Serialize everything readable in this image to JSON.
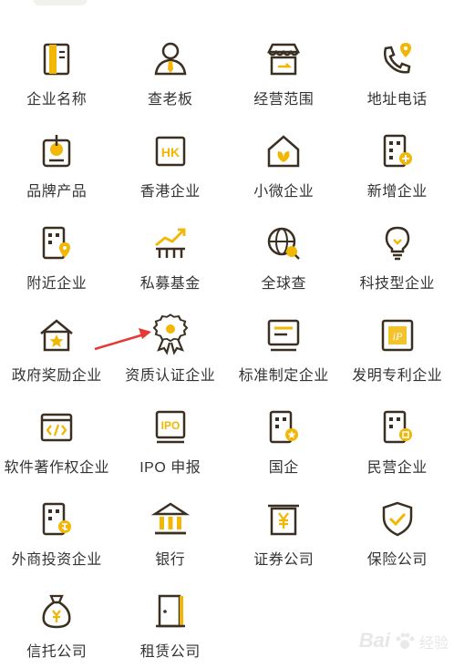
{
  "colors": {
    "accent": "#f2b705",
    "stroke": "#3b2f22",
    "arrow": "#e53935"
  },
  "grid": {
    "items": [
      {
        "label": "企业名称",
        "icon": "building-card-icon"
      },
      {
        "label": "查老板",
        "icon": "person-tie-icon"
      },
      {
        "label": "经营范围",
        "icon": "storefront-icon"
      },
      {
        "label": "地址电话",
        "icon": "phone-location-icon"
      },
      {
        "label": "品牌产品",
        "icon": "brand-product-icon"
      },
      {
        "label": "香港企业",
        "icon": "hk-badge-icon"
      },
      {
        "label": "小微企业",
        "icon": "home-leaf-icon"
      },
      {
        "label": "新增企业",
        "icon": "building-plus-icon"
      },
      {
        "label": "附近企业",
        "icon": "building-pin-icon"
      },
      {
        "label": "私募基金",
        "icon": "growth-chart-icon"
      },
      {
        "label": "全球查",
        "icon": "globe-search-icon"
      },
      {
        "label": "科技型企业",
        "icon": "lightbulb-icon"
      },
      {
        "label": "政府奖励企业",
        "icon": "home-star-icon"
      },
      {
        "label": "资质认证企业",
        "icon": "award-ribbon-icon"
      },
      {
        "label": "标准制定企业",
        "icon": "monitor-doc-icon"
      },
      {
        "label": "发明专利企业",
        "icon": "patent-doc-icon"
      },
      {
        "label": "软件著作权企业",
        "icon": "code-window-icon"
      },
      {
        "label": "IPO 申报",
        "icon": "ipo-badge-icon"
      },
      {
        "label": "国企",
        "icon": "building-star-icon"
      },
      {
        "label": "民营企业",
        "icon": "building-private-icon"
      },
      {
        "label": "外商投资企业",
        "icon": "building-foreign-icon"
      },
      {
        "label": "银行",
        "icon": "bank-icon"
      },
      {
        "label": "证券公司",
        "icon": "yen-board-icon"
      },
      {
        "label": "保险公司",
        "icon": "shield-check-icon"
      },
      {
        "label": "信托公司",
        "icon": "money-bag-icon"
      },
      {
        "label": "租赁公司",
        "icon": "door-icon"
      }
    ]
  },
  "watermark": {
    "logo": "Bai",
    "sub": "经验"
  }
}
